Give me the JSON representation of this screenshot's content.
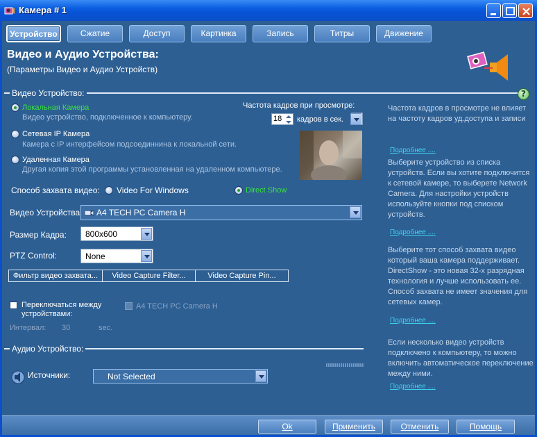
{
  "window": {
    "title": "Камера # 1"
  },
  "tabs": [
    {
      "label": "Устройство",
      "active": true
    },
    {
      "label": "Сжатие"
    },
    {
      "label": "Доступ"
    },
    {
      "label": "Картинка"
    },
    {
      "label": "Запись"
    },
    {
      "label": "Титры"
    },
    {
      "label": "Движение"
    }
  ],
  "header": {
    "title": "Видео и Аудио Устройства:",
    "subtitle": "(Параметры Видео и Аудио Устройств)"
  },
  "video_section": {
    "label": "Видео Устройство:",
    "options": [
      {
        "label": "Локальная Камера",
        "description": "Видео устройство, подключенное к компьютеру.",
        "selected": true
      },
      {
        "label": "Сетевая IP Камера",
        "description": "Камера с IP интерфейсом подсоединнина к локальной сети."
      },
      {
        "label": "Удаленная Камера",
        "description": "Другая копия этой программы установленная на удаленном компьютере."
      }
    ],
    "fps_label": "Частота кадров при просмотре:",
    "fps_value": "18",
    "fps_unit": "кадров в сек.",
    "capture_method_label": "Способ захвата видео:",
    "capture_vfw": "Video For Windows",
    "capture_ds": "Direct Show",
    "device_label": "Видео Устройства:",
    "device_value": "A4 TECH PC Camera H",
    "frame_size_label": "Размер Кадра:",
    "frame_size_value": "800x600",
    "ptz_label": "PTZ Control:",
    "ptz_value": "None",
    "filter_buttons": [
      "Фильтр видео захвата...",
      "Video Capture Filter...",
      "Video Capture Pin..."
    ],
    "switch_label_1": "Переключаться между",
    "switch_label_2": "устройствами:",
    "switch_device": "A4 TECH PC Camera H",
    "interval_label": "Интервал:",
    "interval_value": "30",
    "interval_unit": "sec."
  },
  "audio_section": {
    "label": "Аудио Устройство:",
    "sources_label": "Источники:",
    "sources_value": "Not Selected"
  },
  "help": {
    "text1": "Частота кадров в просмотре не влияет на частоту кадров уд.доступа и записи",
    "more1": "Подробнее ....",
    "text2": "Выберите устройство из списка устройств. Если вы хотите подключится к сетевой камере, то выберете Network Camera. Для настройки устройств используйте кнопки под списком устройств.",
    "more2": "Подробнее ....",
    "text3": "Выберите тот способ захвата видео который ваша камера поддерживает. DirectShow - это новая 32-х разрядная технология и лучше использовать ее. Способ захвата не имеет значения для сетевых камер.",
    "more3": "Подробнее ....",
    "text4": "Если несколько видео устройств подключено к компьютеру, то можно включить автоматическое переключение между ними.",
    "more4": "Подробнее ...."
  },
  "footer": {
    "ok": "Ok",
    "apply": "Применить",
    "cancel": "Отменить",
    "help": "Помощь"
  },
  "colors": {
    "background": "#2d5f93",
    "titlebar": "#0a5de0",
    "selected_option": "#39e33a",
    "link": "#3ed3f0"
  }
}
